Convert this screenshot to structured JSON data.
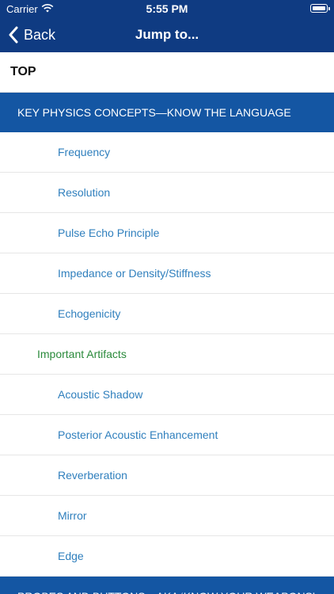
{
  "status_bar": {
    "carrier": "Carrier",
    "time": "5:55 PM"
  },
  "nav": {
    "back_label": "Back",
    "title": "Jump to..."
  },
  "list": {
    "top": "TOP",
    "section1": "KEY PHYSICS CONCEPTS—KNOW THE LANGUAGE",
    "items": [
      "Frequency",
      "Resolution",
      "Pulse Echo Principle",
      "Impedance or Density/Stiffness",
      "Echogenicity"
    ],
    "subheading": "Important Artifacts",
    "artifacts": [
      "Acoustic Shadow",
      "Posterior Acoustic Enhancement",
      "Reverberation",
      "Mirror",
      "Edge"
    ],
    "section2": "PROBES AND BUTTONS—AKA ‘KNOW YOUR WEAPONS’"
  },
  "colors": {
    "header": "#0f3b82",
    "section": "#1456a3",
    "item_text": "#2f7fbd",
    "subheading_text": "#2a8a3b"
  },
  "icons": [
    "wifi-icon",
    "battery-icon",
    "chevron-left-icon"
  ]
}
